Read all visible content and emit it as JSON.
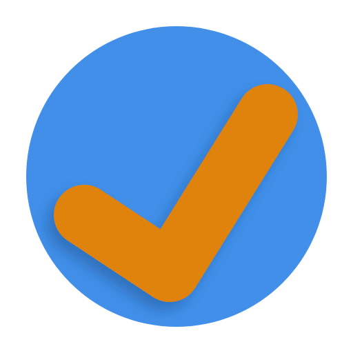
{
  "icon": {
    "name": "checkmark-icon",
    "circle_color": "#418FE9",
    "check_color": "#E0830D",
    "background_color": "#FFFFFF",
    "shadow_color": "#1B4F8A"
  }
}
